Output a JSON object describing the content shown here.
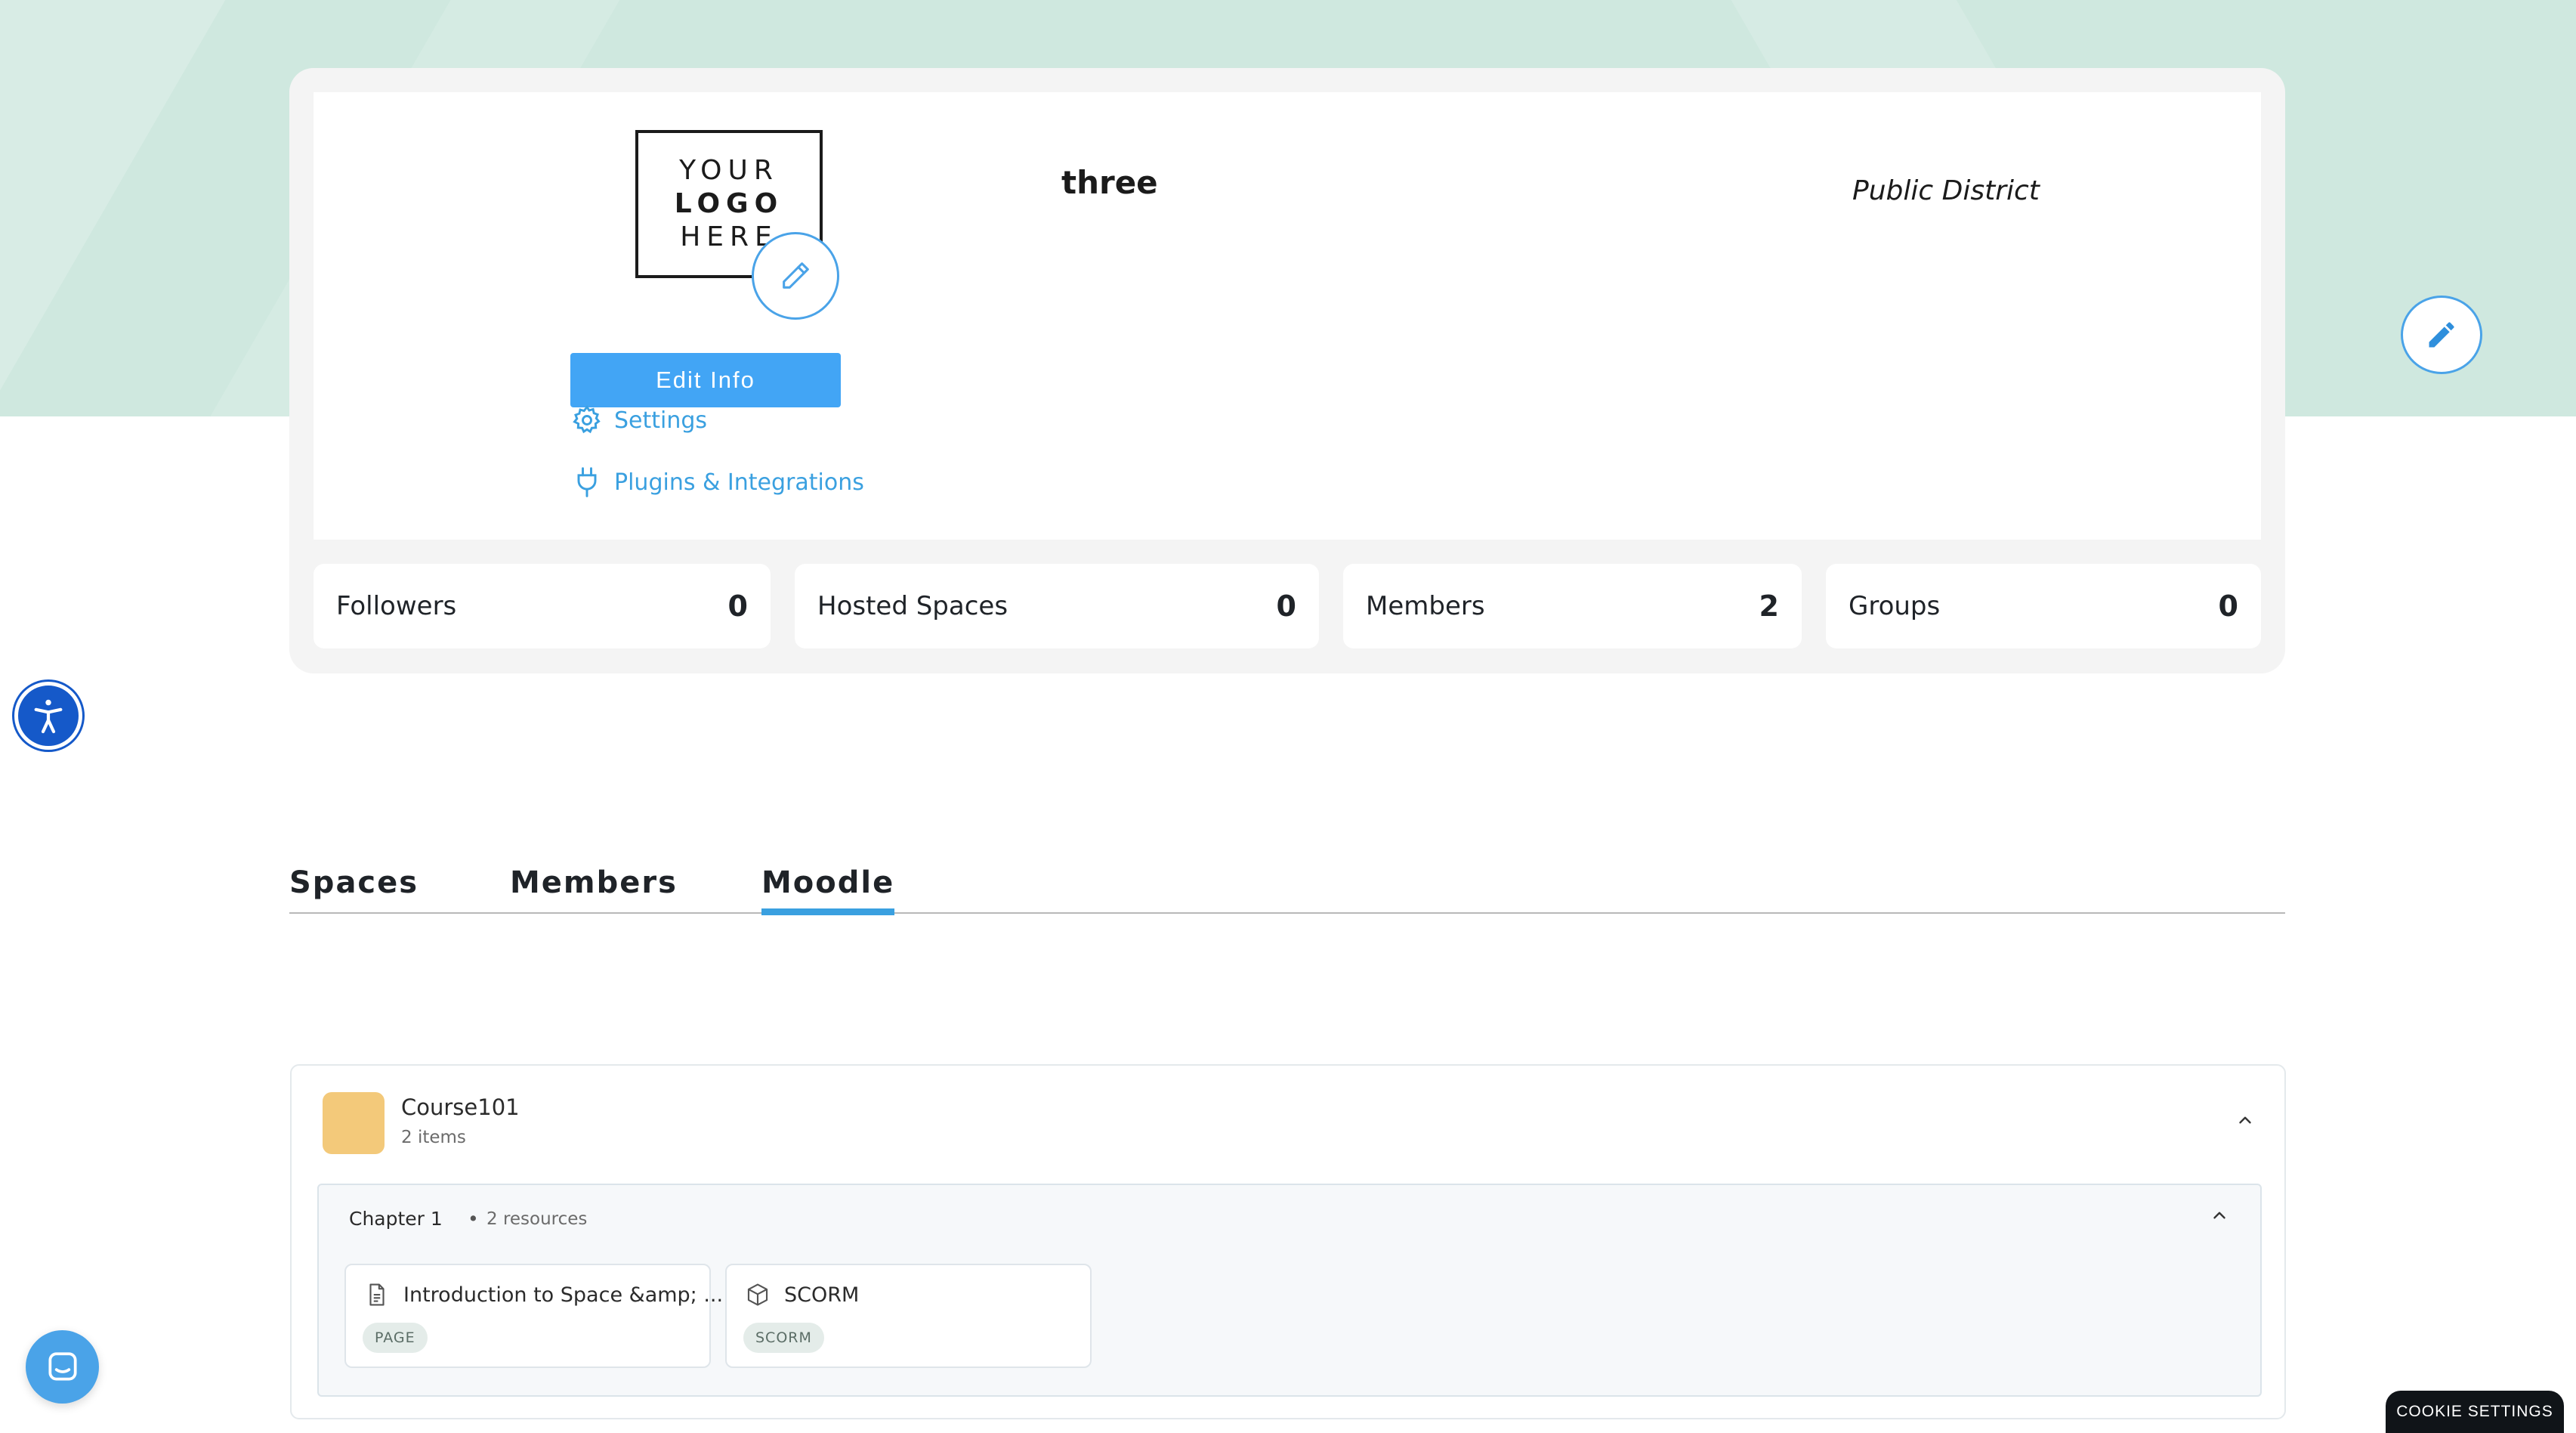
{
  "banner": {
    "edit_icon": "pencil-icon"
  },
  "profile": {
    "logo_lines": [
      "YOUR",
      "LOGO",
      "HERE"
    ],
    "logo_edit_icon": "pencil-outline-icon",
    "edit_info_label": "Edit Info",
    "settings_label": "Settings",
    "plugins_label": "Plugins & Integrations",
    "name": "three",
    "district_type": "Public District"
  },
  "stats": [
    {
      "label": "Followers",
      "value": "0"
    },
    {
      "label": "Hosted Spaces",
      "value": "0"
    },
    {
      "label": "Members",
      "value": "2"
    },
    {
      "label": "Groups",
      "value": "0"
    }
  ],
  "tabs": [
    {
      "label": "Spaces",
      "active": false
    },
    {
      "label": "Members",
      "active": false
    },
    {
      "label": "Moodle",
      "active": true
    }
  ],
  "course": {
    "title": "Course101",
    "item_count": "2 items",
    "chapter": {
      "title": "Chapter 1",
      "separator": "•",
      "resource_count": "2 resources",
      "resources": [
        {
          "title": "Introduction to Space &amp; ...",
          "badge": "PAGE",
          "icon": "document-icon"
        },
        {
          "title": "SCORM",
          "badge": "SCORM",
          "icon": "package-icon"
        }
      ]
    }
  },
  "cookie_settings_label": "COOKIE SETTINGS",
  "colors": {
    "accent": "#42a5f5",
    "banner": "#cfe8df",
    "accessibility": "#1559c9"
  }
}
